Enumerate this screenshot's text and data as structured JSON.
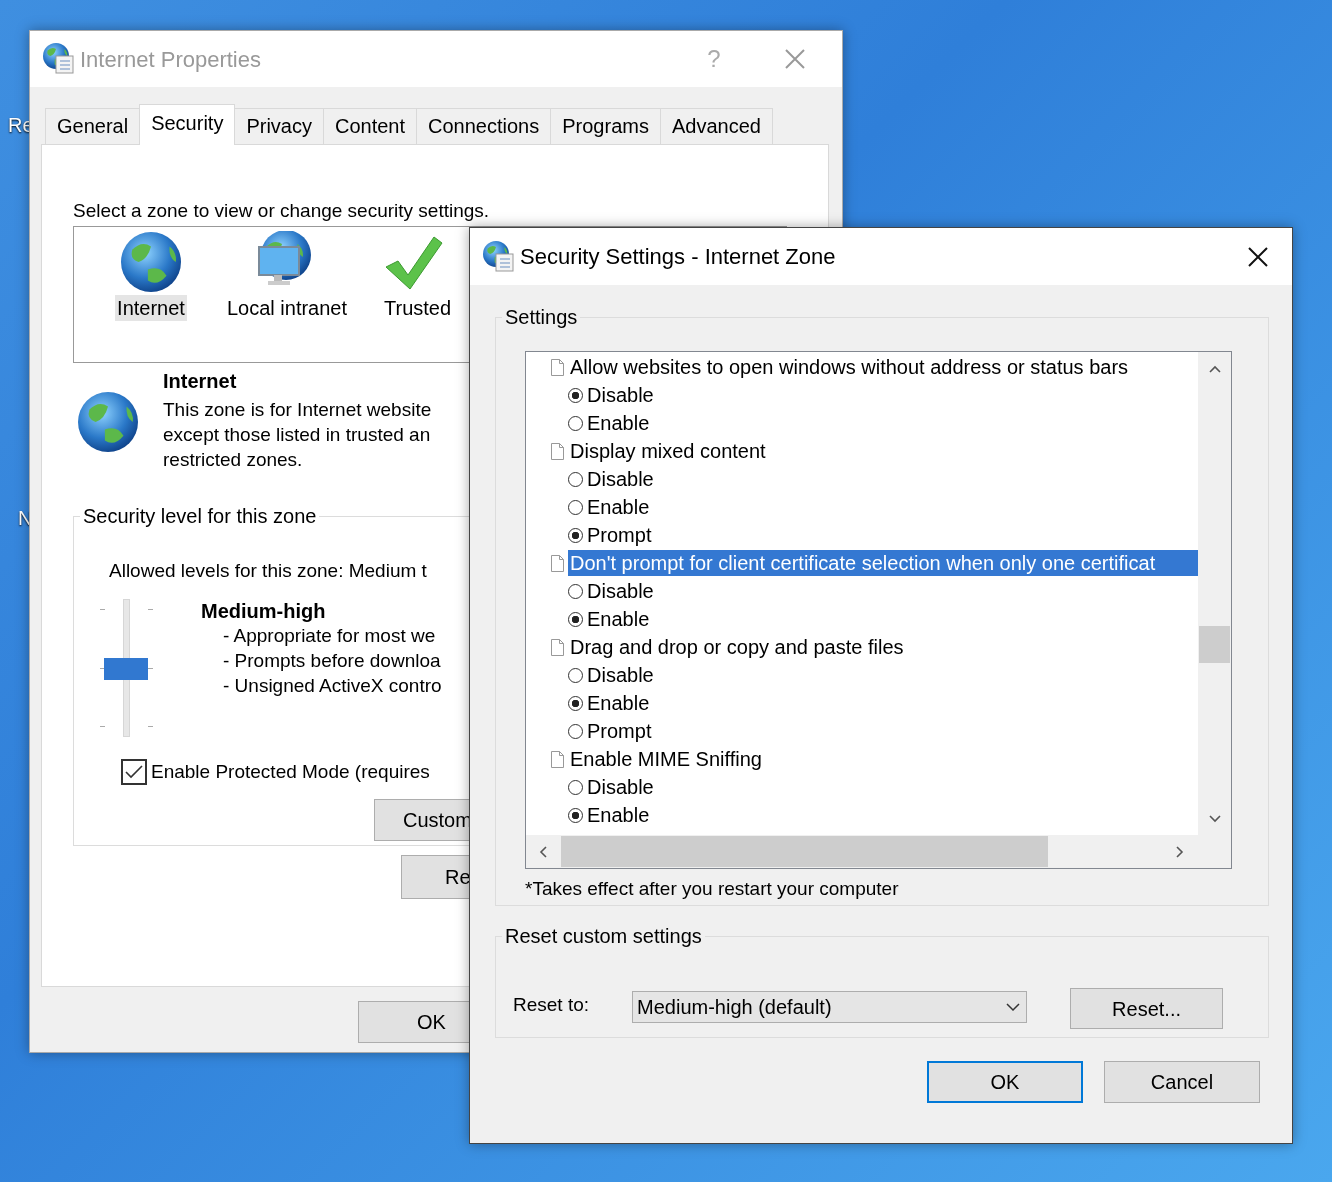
{
  "desktop_icons": [
    {
      "label": "Re"
    },
    {
      "label": "N"
    }
  ],
  "internet_properties": {
    "title": "Internet Properties",
    "help_button": "?",
    "tabs": [
      {
        "label": "General",
        "selected": false
      },
      {
        "label": "Security",
        "selected": true
      },
      {
        "label": "Privacy",
        "selected": false
      },
      {
        "label": "Content",
        "selected": false
      },
      {
        "label": "Connections",
        "selected": false
      },
      {
        "label": "Programs",
        "selected": false
      },
      {
        "label": "Advanced",
        "selected": false
      }
    ],
    "zone_prompt": "Select a zone to view or change security settings.",
    "zones": [
      {
        "label": "Internet",
        "kind": "globe",
        "selected": true
      },
      {
        "label": "Local intranet",
        "kind": "intranet",
        "selected": false
      },
      {
        "label": "Trusted",
        "kind": "trusted",
        "selected": false
      }
    ],
    "zone_heading": "Internet",
    "zone_description": "This zone is for Internet website\nexcept those listed in trusted an\nrestricted zones.",
    "level_group": "Security level for this zone",
    "allowed_levels": "Allowed levels for this zone: Medium t",
    "slider": {
      "level": 0.5
    },
    "level_name": "Medium-high",
    "level_points": [
      "- Appropriate for most we",
      "- Prompts before downloa",
      "- Unsigned ActiveX contro"
    ],
    "protected_mode": {
      "label": "Enable Protected Mode (requires",
      "checked": true
    },
    "custom_button": "Custom",
    "reset_button": "Re",
    "ok_button": "OK"
  },
  "security_settings": {
    "title": "Security Settings - Internet Zone",
    "settings_group": "Settings",
    "items": [
      {
        "label": "Allow websites to open windows without address or status bars",
        "selected": false,
        "options": [
          {
            "label": "Disable",
            "selected": true
          },
          {
            "label": "Enable",
            "selected": false
          }
        ]
      },
      {
        "label": "Display mixed content",
        "selected": false,
        "options": [
          {
            "label": "Disable",
            "selected": false
          },
          {
            "label": "Enable",
            "selected": false
          },
          {
            "label": "Prompt",
            "selected": true
          }
        ]
      },
      {
        "label": "Don't prompt for client certificate selection when only one certificat",
        "selected": true,
        "options": [
          {
            "label": "Disable",
            "selected": false
          },
          {
            "label": "Enable",
            "selected": true
          }
        ]
      },
      {
        "label": "Drag and drop or copy and paste files",
        "selected": false,
        "options": [
          {
            "label": "Disable",
            "selected": false
          },
          {
            "label": "Enable",
            "selected": true
          },
          {
            "label": "Prompt",
            "selected": false
          }
        ]
      },
      {
        "label": "Enable MIME Sniffing",
        "selected": false,
        "options": [
          {
            "label": "Disable",
            "selected": false
          },
          {
            "label": "Enable",
            "selected": true
          }
        ]
      }
    ],
    "note": "*Takes effect after you restart your computer",
    "reset_group": "Reset custom settings",
    "reset_label": "Reset to:",
    "reset_value": "Medium-high (default)",
    "reset_button": "Reset...",
    "ok_button": "OK",
    "cancel_button": "Cancel"
  }
}
